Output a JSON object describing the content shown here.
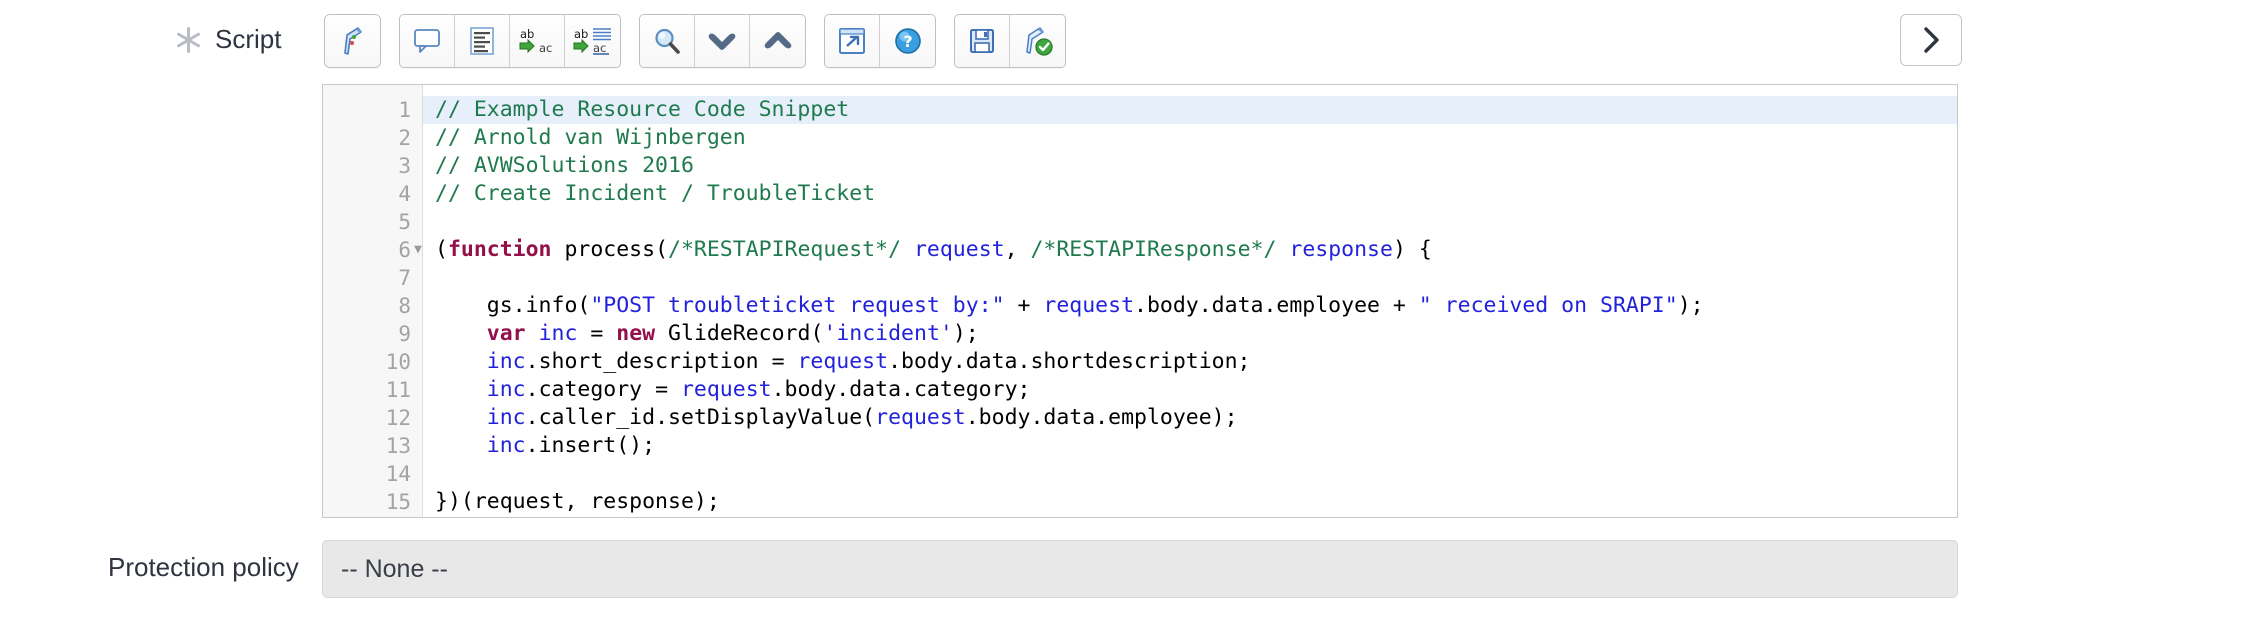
{
  "form": {
    "script_field": {
      "label": "Script",
      "required_marker": "asterisk-icon"
    },
    "protection_policy": {
      "label": "Protection policy",
      "value": "-- None --"
    }
  },
  "toolbar": {
    "groups": [
      {
        "buttons": [
          {
            "name": "syntax-editor-toggle-icon",
            "title": "Toggle syntax editor"
          }
        ]
      },
      {
        "buttons": [
          {
            "name": "comment-icon",
            "title": "Comment"
          },
          {
            "name": "format-code-icon",
            "title": "Format code"
          },
          {
            "name": "replace-icon",
            "title": "Replace"
          },
          {
            "name": "replace-all-icon",
            "title": "Replace all"
          }
        ]
      },
      {
        "buttons": [
          {
            "name": "search-icon",
            "title": "Find"
          },
          {
            "name": "chevron-down-icon",
            "title": "Find next"
          },
          {
            "name": "chevron-up-icon",
            "title": "Find previous"
          }
        ]
      },
      {
        "buttons": [
          {
            "name": "open-in-new-window-icon",
            "title": "Open in new window"
          },
          {
            "name": "help-icon",
            "title": "Help"
          }
        ]
      },
      {
        "buttons": [
          {
            "name": "save-icon",
            "title": "Save"
          },
          {
            "name": "syntax-check-icon",
            "title": "Syntax check"
          }
        ]
      }
    ],
    "next_button": {
      "name": "chevron-right-icon",
      "title": "Next"
    }
  },
  "editor": {
    "active_line": 1,
    "lines": [
      {
        "n": "1",
        "fold": "",
        "tokens": [
          {
            "t": "com",
            "s": "// Example Resource Code Snippet"
          }
        ]
      },
      {
        "n": "2",
        "fold": "",
        "tokens": [
          {
            "t": "com",
            "s": "// Arnold van Wijnbergen"
          }
        ]
      },
      {
        "n": "3",
        "fold": "",
        "tokens": [
          {
            "t": "com",
            "s": "// AVWSolutions 2016"
          }
        ]
      },
      {
        "n": "4",
        "fold": "",
        "tokens": [
          {
            "t": "com",
            "s": "// Create Incident / TroubleTicket"
          }
        ]
      },
      {
        "n": "5",
        "fold": "",
        "tokens": []
      },
      {
        "n": "6",
        "fold": "▼",
        "tokens": [
          {
            "t": "pln",
            "s": "("
          },
          {
            "t": "kw",
            "s": "function"
          },
          {
            "t": "pln",
            "s": " process("
          },
          {
            "t": "com",
            "s": "/*RESTAPIRequest*/"
          },
          {
            "t": "pln",
            "s": " "
          },
          {
            "t": "var",
            "s": "request"
          },
          {
            "t": "pln",
            "s": ", "
          },
          {
            "t": "com",
            "s": "/*RESTAPIResponse*/"
          },
          {
            "t": "pln",
            "s": " "
          },
          {
            "t": "var",
            "s": "response"
          },
          {
            "t": "pln",
            "s": ") {"
          }
        ]
      },
      {
        "n": "7",
        "fold": "",
        "tokens": []
      },
      {
        "n": "8",
        "fold": "",
        "tokens": [
          {
            "t": "pln",
            "s": "    gs.info("
          },
          {
            "t": "str",
            "s": "\"POST troubleticket request by:\""
          },
          {
            "t": "pln",
            "s": " + "
          },
          {
            "t": "var",
            "s": "request"
          },
          {
            "t": "pln",
            "s": ".body.data.employee + "
          },
          {
            "t": "str",
            "s": "\" received on SRAPI\""
          },
          {
            "t": "pln",
            "s": ");"
          }
        ]
      },
      {
        "n": "9",
        "fold": "",
        "tokens": [
          {
            "t": "pln",
            "s": "    "
          },
          {
            "t": "kw",
            "s": "var"
          },
          {
            "t": "pln",
            "s": " "
          },
          {
            "t": "var",
            "s": "inc"
          },
          {
            "t": "pln",
            "s": " = "
          },
          {
            "t": "kw",
            "s": "new"
          },
          {
            "t": "pln",
            "s": " GlideRecord("
          },
          {
            "t": "str",
            "s": "'incident'"
          },
          {
            "t": "pln",
            "s": ");"
          }
        ]
      },
      {
        "n": "10",
        "fold": "",
        "tokens": [
          {
            "t": "pln",
            "s": "    "
          },
          {
            "t": "var",
            "s": "inc"
          },
          {
            "t": "pln",
            "s": ".short_description = "
          },
          {
            "t": "var",
            "s": "request"
          },
          {
            "t": "pln",
            "s": ".body.data.shortdescription;"
          }
        ]
      },
      {
        "n": "11",
        "fold": "",
        "tokens": [
          {
            "t": "pln",
            "s": "    "
          },
          {
            "t": "var",
            "s": "inc"
          },
          {
            "t": "pln",
            "s": ".category = "
          },
          {
            "t": "var",
            "s": "request"
          },
          {
            "t": "pln",
            "s": ".body.data.category;"
          }
        ]
      },
      {
        "n": "12",
        "fold": "",
        "tokens": [
          {
            "t": "pln",
            "s": "    "
          },
          {
            "t": "var",
            "s": "inc"
          },
          {
            "t": "pln",
            "s": ".caller_id.setDisplayValue("
          },
          {
            "t": "var",
            "s": "request"
          },
          {
            "t": "pln",
            "s": ".body.data.employee);"
          }
        ]
      },
      {
        "n": "13",
        "fold": "",
        "tokens": [
          {
            "t": "pln",
            "s": "    "
          },
          {
            "t": "var",
            "s": "inc"
          },
          {
            "t": "pln",
            "s": ".insert();"
          }
        ]
      },
      {
        "n": "14",
        "fold": "",
        "tokens": []
      },
      {
        "n": "15",
        "fold": "",
        "tokens": [
          {
            "t": "pln",
            "s": "})(request, response);"
          }
        ]
      }
    ]
  },
  "colors": {
    "comment": "#1f7a4d",
    "keyword": "#93104b",
    "string": "#2222dd",
    "variable": "#2222dd",
    "plain": "#000000",
    "active_line_bg": "#e7effb",
    "field_bg": "#e8e8e8"
  }
}
